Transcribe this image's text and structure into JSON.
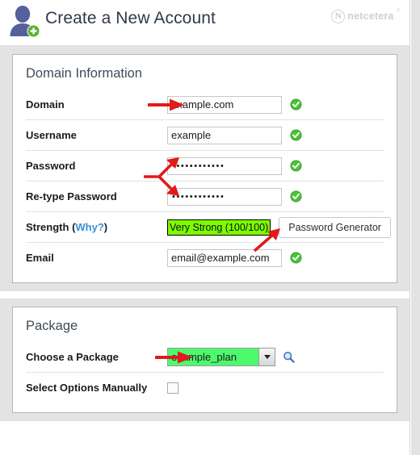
{
  "header": {
    "title": "Create a New Account",
    "user_add_icon": "user-add-icon",
    "brand": {
      "mark_letter": "N",
      "name": "netcetera",
      "tm": "®"
    }
  },
  "sections": [
    {
      "id": "domain-information",
      "title": "Domain Information",
      "rows": [
        {
          "id": "domain",
          "label": "Domain",
          "type": "text",
          "value": "example.com",
          "placeholder": "",
          "valid_icon": "green-check-icon",
          "annotation": "red-arrow-right"
        },
        {
          "id": "username",
          "label": "Username",
          "type": "text",
          "value": "example",
          "placeholder": "",
          "valid_icon": "green-check-icon",
          "annotation": ""
        },
        {
          "id": "password",
          "label": "Password",
          "type": "password",
          "value": "••••••••••••",
          "placeholder": "",
          "valid_icon": "green-check-icon",
          "annotation": "red-double-arrow"
        },
        {
          "id": "retype-password",
          "label": "Re-type Password",
          "type": "password",
          "value": "••••••••••••",
          "placeholder": "",
          "valid_icon": "green-check-icon",
          "annotation": "red-double-arrow"
        },
        {
          "id": "strength",
          "label": "Strength",
          "label_link": "Why?",
          "type": "strength",
          "value": "Very Strong (100/100)",
          "button_label": "Password Generator",
          "annotation": "red-arrow-up-right"
        },
        {
          "id": "email",
          "label": "Email",
          "type": "text",
          "value": "email@example.com",
          "placeholder": "",
          "valid_icon": "green-check-icon",
          "annotation": ""
        }
      ]
    },
    {
      "id": "package",
      "title": "Package",
      "rows": [
        {
          "id": "choose-a-package",
          "label": "Choose a Package",
          "type": "select",
          "value": "example_plan",
          "options": [
            "example_plan"
          ],
          "search_icon": "magnifier-icon",
          "annotation": "red-arrow-right"
        },
        {
          "id": "select-options-manually",
          "label": "Select Options Manually",
          "type": "checkbox",
          "checked": false,
          "annotation": ""
        }
      ]
    }
  ],
  "colors": {
    "accent_link": "#3b8fd4",
    "strength_green": "#7cfc00",
    "package_green": "#4dfa6e",
    "valid_green": "#3aa82c",
    "annotation_red": "#e01b1b",
    "avatar_blue": "#55619b",
    "page_band": "#e3e3e3"
  }
}
